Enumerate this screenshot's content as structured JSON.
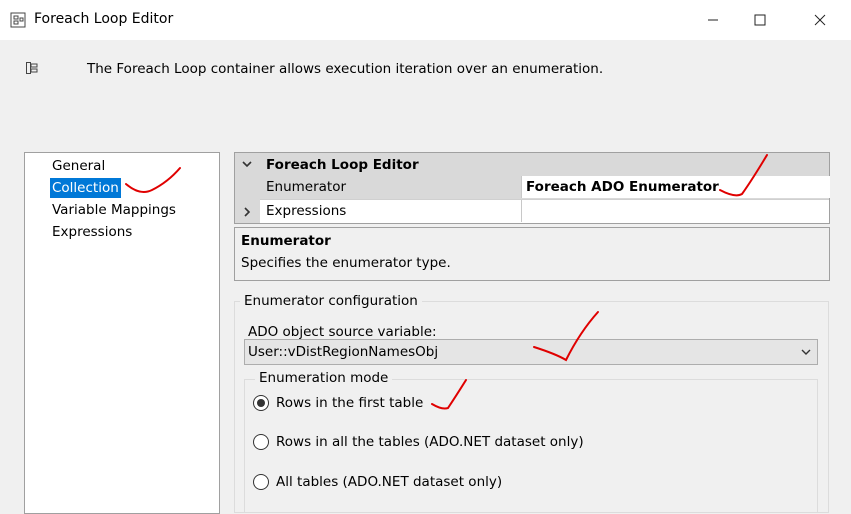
{
  "window": {
    "title": "Foreach Loop Editor",
    "minimize_icon": "minimize-icon",
    "maximize_icon": "maximize-icon",
    "close_icon": "close-icon"
  },
  "description": "The Foreach Loop container allows execution iteration over an enumeration.",
  "nav": {
    "items": [
      "General",
      "Collection",
      "Variable Mappings",
      "Expressions"
    ],
    "selected": "Collection"
  },
  "property_grid": {
    "category": "Foreach Loop Editor",
    "rows": [
      {
        "name": "Enumerator",
        "value": "Foreach ADO Enumerator"
      },
      {
        "name": "Expressions",
        "value": ""
      }
    ]
  },
  "help": {
    "title": "Enumerator",
    "text": "Specifies the enumerator type."
  },
  "enumerator_config": {
    "group_label": "Enumerator configuration",
    "source_label": "ADO object source variable:",
    "source_value": "User::vDistRegionNamesObj",
    "mode_label": "Enumeration mode",
    "options": [
      "Rows in the first table",
      "Rows in all the tables (ADO.NET dataset only)",
      "All tables (ADO.NET dataset only)"
    ],
    "selected": "Rows in the first table"
  },
  "colors": {
    "selection": "#0078d7",
    "annotation": "#e00000"
  }
}
